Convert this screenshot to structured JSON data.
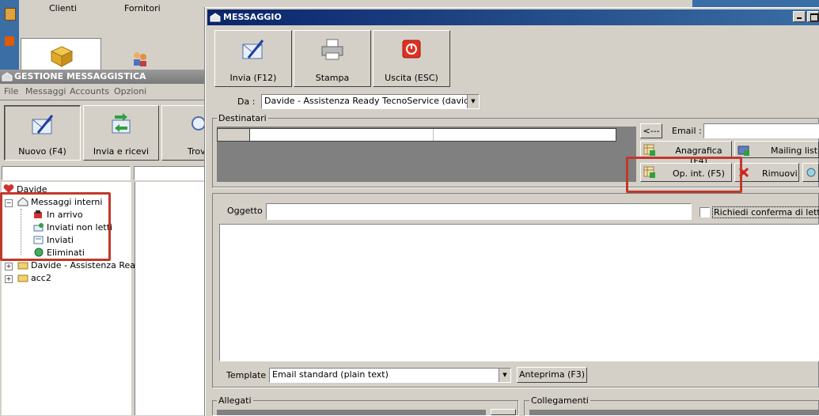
{
  "background_app": {
    "menu": [
      "Clienti",
      "Fornitori"
    ]
  },
  "gestione": {
    "title": "GESTIONE MESSAGGISTICA",
    "menu": [
      "File",
      "Messaggi",
      "Accounts",
      "Opzioni"
    ],
    "toolbar": {
      "nuovo": "Nuovo (F4)",
      "invia_ricevi": "Invia e ricevi",
      "trova": "Trov"
    },
    "tree": {
      "root": "Davide",
      "messaggi_interni": "Messaggi interni",
      "in_arrivo": "In arrivo",
      "inviati_non_letti": "Inviati non letti",
      "inviati": "Inviati",
      "eliminati": "Eliminati",
      "account": "Davide - Assistenza Read",
      "acc2": "acc2"
    }
  },
  "messaggio": {
    "title": "MESSAGGIO",
    "toolbar": {
      "invia": "Invia (F12)",
      "stampa": "Stampa",
      "uscita": "Uscita (ESC)"
    },
    "da_label": "Da :",
    "da_value": "Davide - Assistenza Ready TecnoService (davide@re",
    "destinatari_label": "Destinatari",
    "back_button": "<---",
    "email_label": "Email :",
    "email_value": "",
    "anagrafica_button": "Anagrafica (F4)",
    "mailing_list_button": "Mailing list",
    "op_int_button": "Op. int. (F5)",
    "rimuovi_button": "Rimuovi",
    "oggetto_label": "Oggetto :",
    "oggetto_value": "",
    "richiedi_conferma_label": "Richiedi conferma di lettura",
    "richiedi_conferma_checked": false,
    "body_value": "",
    "template_label": "Template :",
    "template_value": "Email standard (plain text)",
    "anteprima_button": "Anteprima (F3)",
    "allegati_label": "Allegati",
    "collegamenti_label": "Collegamenti"
  },
  "colors": {
    "title_bar": "#0a246a",
    "title_bar_end": "#3a6ea5",
    "inactive_title": "#808080",
    "highlight_box": "#c0392b",
    "face": "#d4d0c8"
  }
}
